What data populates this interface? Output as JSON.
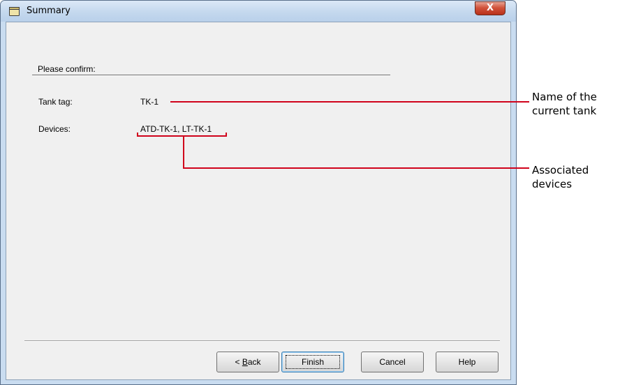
{
  "window": {
    "title": "Summary",
    "close_glyph": "X"
  },
  "summary": {
    "heading": "Please confirm:",
    "tank_tag_label": "Tank tag:",
    "tank_tag_value": "TK-1",
    "devices_label": "Devices:",
    "devices_value": "ATD-TK-1, LT-TK-1"
  },
  "buttons": {
    "back_prefix": "< ",
    "back_mnemonic": "B",
    "back_rest": "ack",
    "finish": "Finish",
    "cancel": "Cancel",
    "help": "Help"
  },
  "annotations": {
    "tank_name_line1": "Name of the",
    "tank_name_line2": "current tank",
    "devices_line1": "Associated",
    "devices_line2": "devices"
  },
  "colors": {
    "annotation": "#d0021b",
    "titlebar": "#c4d8ee",
    "client_bg": "#f0f0f0"
  }
}
